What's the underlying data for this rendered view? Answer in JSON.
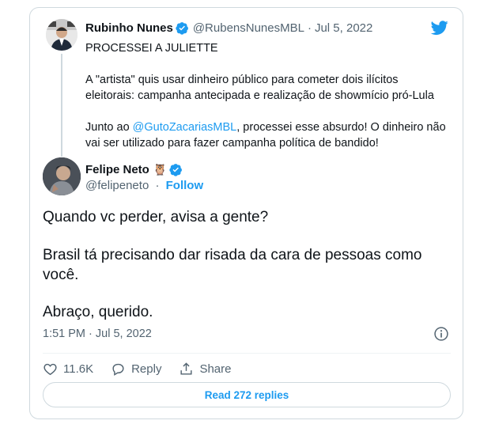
{
  "parent": {
    "name": "Rubinho Nunes",
    "handle": "@RubensNunesMBL",
    "separator": "·",
    "date": "Jul 5, 2022",
    "line1": "PROCESSEI A JULIETTE",
    "para2_line1": "A \"artista\" quis usar dinheiro público para cometer dois ilícitos",
    "para2_line2": "eleitorais: campanha antecipada e realização de showmício pró-Lula",
    "para3_before": "Junto ao ",
    "para3_mention": "@GutoZacariasMBL",
    "para3_after": ", processei esse absurdo! O dinheiro não",
    "para3_line2": "vai ser utilizado para fazer campanha política de bandido!"
  },
  "main": {
    "name": "Felipe Neto",
    "emoji": "🦉",
    "handle": "@felipeneto",
    "separator": "·",
    "follow_label": "Follow",
    "text_line1": "Quando vc perder, avisa a gente?",
    "text_line2": "Brasil tá precisando dar risada da cara de pessoas como",
    "text_line3": "você.",
    "text_line4": "Abraço, querido.",
    "timestamp": "1:51 PM · Jul 5, 2022"
  },
  "actions": {
    "likes": "11.6K",
    "reply_label": "Reply",
    "share_label": "Share",
    "read_replies_label": "Read 272 replies"
  },
  "colors": {
    "accent": "#1d9bf0",
    "text": "#0f1419",
    "muted": "#536471",
    "border": "#cfd9de"
  },
  "icons": [
    "twitter-bird-icon",
    "verified-badge-icon",
    "info-icon",
    "heart-icon",
    "reply-bubble-icon",
    "share-icon"
  ]
}
